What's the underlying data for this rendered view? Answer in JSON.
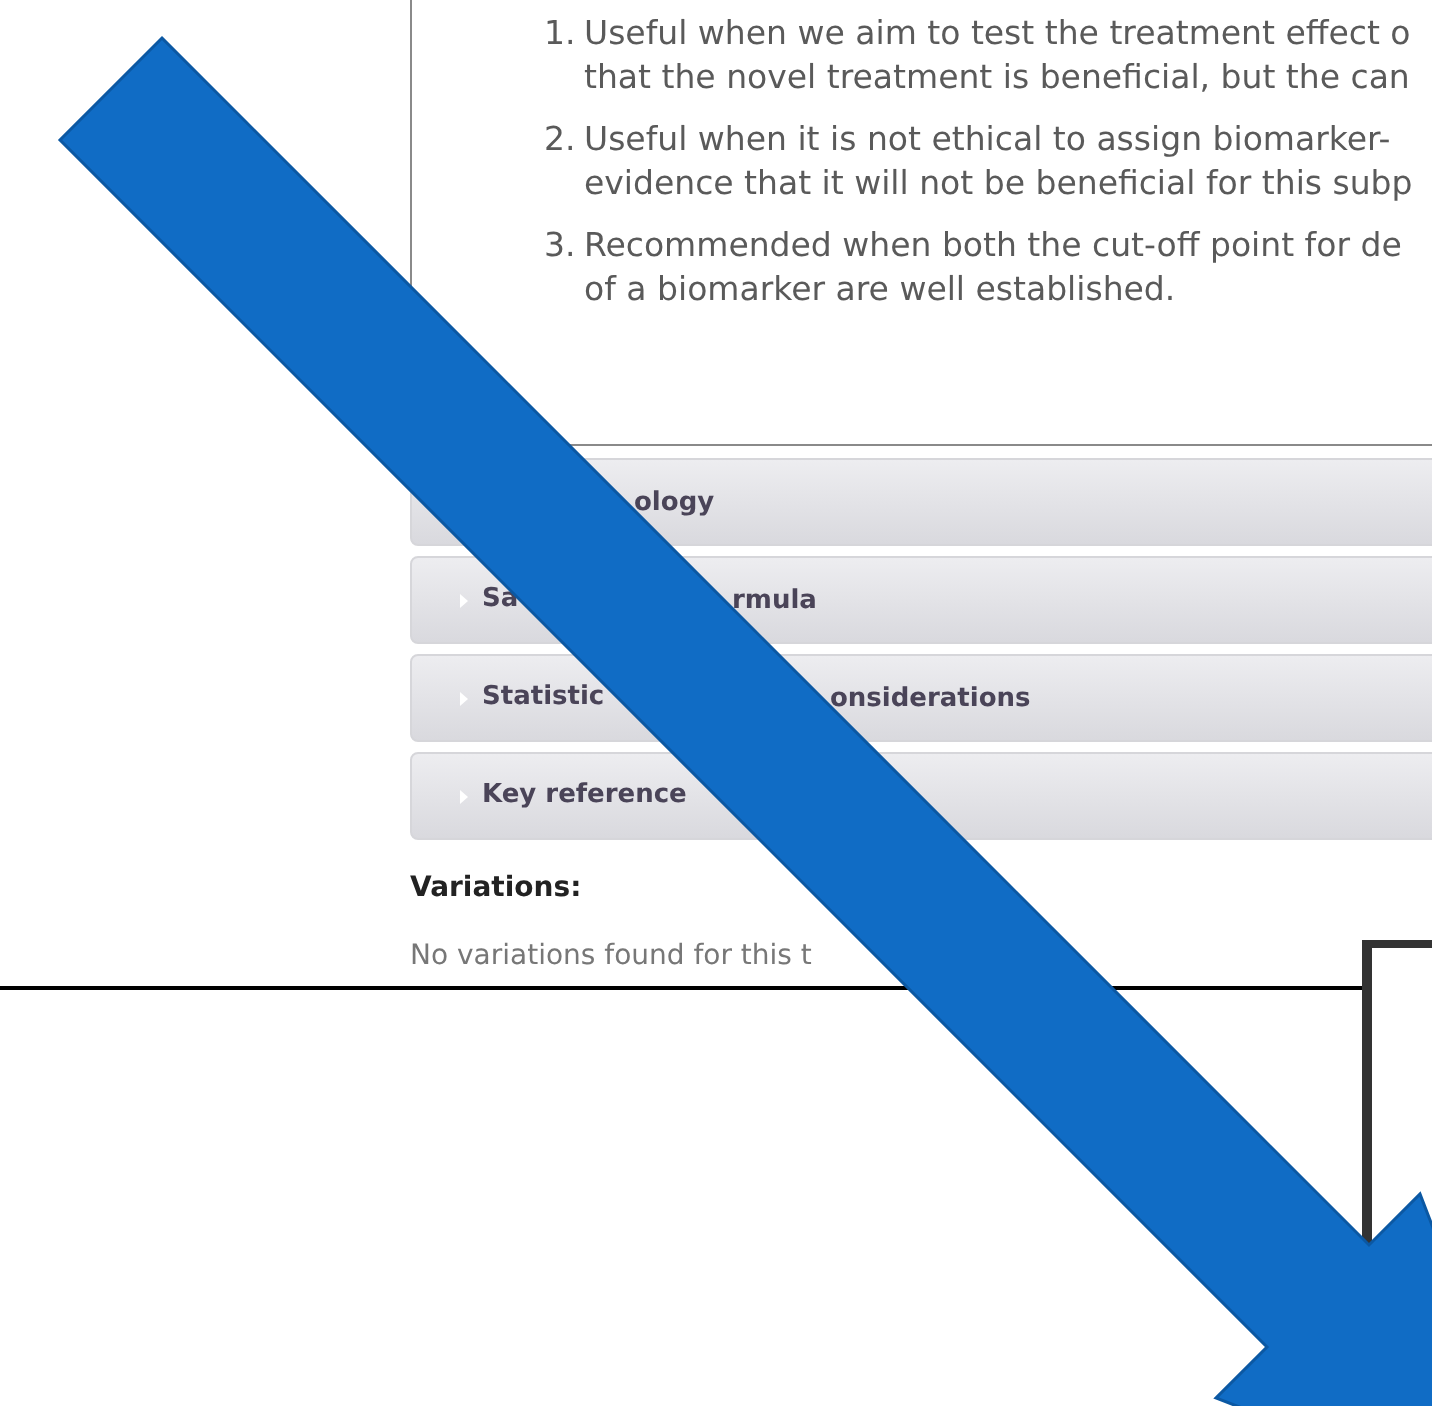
{
  "list_items": [
    {
      "number": "1.",
      "lines": [
        "Useful when we aim to test the treatment effect o",
        "that the novel treatment is beneficial, but the can"
      ]
    },
    {
      "number": "2.",
      "lines": [
        "Useful when it is not ethical to assign biomarker-",
        "evidence that it will not be beneficial for this subp"
      ]
    },
    {
      "number": "3.",
      "lines": [
        "Recommended when both the cut-off point for de",
        "of a biomarker are well established."
      ]
    }
  ],
  "accordions": [
    {
      "visible_end": "ology"
    },
    {
      "visible_start": "Sa",
      "visible_end": "rmula"
    },
    {
      "visible_start": "Statistic",
      "visible_end": "onsiderations"
    },
    {
      "visible_start": "Key reference"
    }
  ],
  "variations": {
    "heading": "Variations:",
    "message": "No variations found for this t"
  }
}
